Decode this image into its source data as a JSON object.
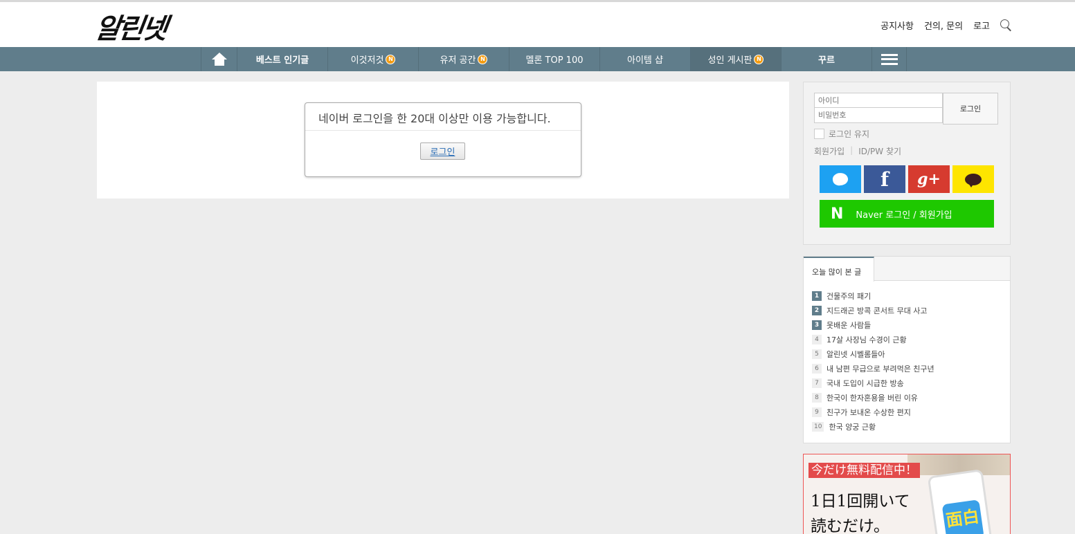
{
  "header": {
    "logo": "알린넷",
    "links": [
      "공지사항",
      "건의, 문의",
      "로고"
    ]
  },
  "nav": {
    "items": [
      {
        "label": "베스트 인기글",
        "badge": ""
      },
      {
        "label": "이것저것",
        "badge": "N"
      },
      {
        "label": "유저 공간",
        "badge": "N"
      },
      {
        "label": "멜론 TOP 100",
        "badge": ""
      },
      {
        "label": "아이템 샵",
        "badge": ""
      },
      {
        "label": "성인 게시판",
        "badge": "N"
      },
      {
        "label": "꾸르",
        "badge": ""
      }
    ]
  },
  "dialog": {
    "message": "네이버 로그인을 한 20대 이상만 이용 가능합니다.",
    "button": "로그인"
  },
  "login": {
    "id_placeholder": "아이디",
    "pw_placeholder": "비밀번호",
    "login_button": "로그인",
    "keep_label": "로그인 유지",
    "join": "회원가입",
    "find": "ID/PW 찾기",
    "google_label": "g+",
    "facebook_label": "f",
    "naver_n": "N",
    "naver_label": "Naver 로그인 / 회원가입"
  },
  "popular": {
    "tab": "오늘 많이 본 글",
    "items": [
      {
        "rank": "1",
        "title": "건물주의 패기"
      },
      {
        "rank": "2",
        "title": "지드래곤 방콕 콘서트 무대 사고"
      },
      {
        "rank": "3",
        "title": "못배운 사람들"
      },
      {
        "rank": "4",
        "title": "17살 사장님 수경이 근황"
      },
      {
        "rank": "5",
        "title": "알린넷 시벨롬들아"
      },
      {
        "rank": "6",
        "title": "내 남편 무급으로 부려먹은 친구년"
      },
      {
        "rank": "7",
        "title": "국내 도입이 시급한 방송"
      },
      {
        "rank": "8",
        "title": "한국이 한자혼용을 버린 이유"
      },
      {
        "rank": "9",
        "title": "친구가 보내온 수상한 편지"
      },
      {
        "rank": "10",
        "title": "한국 양궁 근황"
      }
    ]
  },
  "ad": {
    "tag": "今だけ無料配信中！",
    "line1": "1日1回開いて",
    "line2": "読むだけ。",
    "app_icon_text": "面白"
  },
  "colors": {
    "nav_bg": "#607d8b",
    "twitter": "#1da1f2",
    "facebook": "#3b5998",
    "google": "#d63b2f",
    "kakao": "#fee500",
    "naver": "#1ec800"
  }
}
